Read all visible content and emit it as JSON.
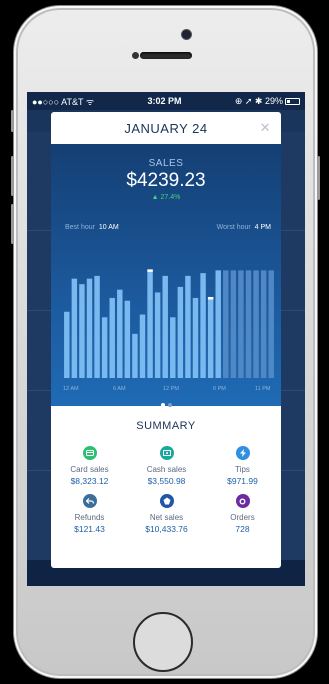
{
  "status_bar": {
    "carrier": "●●○○○ AT&T ᯤ",
    "time": "3:02 PM",
    "right": "⊕ ➚ ✱ 29%"
  },
  "modal": {
    "title": "JANUARY 24",
    "close_icon": "close-icon"
  },
  "sales": {
    "label": "SALES",
    "value": "$4239.23",
    "change": "▲ 27.4%",
    "best_hour_label": "Best hour",
    "best_hour_value": "10 AM",
    "worst_hour_label": "Worst hour",
    "worst_hour_value": "4 PM"
  },
  "chart_data": {
    "type": "bar",
    "x_tick_labels": [
      "12 AM",
      "6 AM",
      "12 PM",
      "6 PM",
      "11 PM"
    ],
    "values": [
      0.48,
      0.72,
      0.68,
      0.72,
      0.74,
      0.44,
      0.58,
      0.64,
      0.56,
      0.32,
      0.46,
      0.78,
      0.62,
      0.74,
      0.44,
      0.66,
      0.74,
      0.58,
      0.76,
      0.58,
      0.78,
      0.78,
      0.78,
      0.78,
      0.78,
      0.78,
      0.78,
      0.78
    ],
    "future_start_index": 21,
    "markers": [
      {
        "index": 11,
        "value": 0.78
      },
      {
        "index": 19,
        "value": 0.58
      }
    ],
    "colors": {
      "bar": "#7ab8f0",
      "future_bar": "#4f88c4",
      "marker": "#ffffff"
    }
  },
  "pager": {
    "count": 2,
    "active": 0
  },
  "summary": {
    "title": "SUMMARY",
    "items": [
      {
        "label": "Card sales",
        "value": "$8,323.12",
        "icon": "card-icon",
        "color": "#2fbf71"
      },
      {
        "label": "Cash sales",
        "value": "$3,550.98",
        "icon": "cash-icon",
        "color": "#19a89a"
      },
      {
        "label": "Tips",
        "value": "$971.99",
        "icon": "lightning-icon",
        "color": "#2f8fe0"
      },
      {
        "label": "Refunds",
        "value": "$121.43",
        "icon": "refund-icon",
        "color": "#3b6f9a"
      },
      {
        "label": "Net sales",
        "value": "$10,433.76",
        "icon": "tag-icon",
        "color": "#1f56a8"
      },
      {
        "label": "Orders",
        "value": "728",
        "icon": "orders-icon",
        "color": "#6a2ca0"
      }
    ]
  }
}
